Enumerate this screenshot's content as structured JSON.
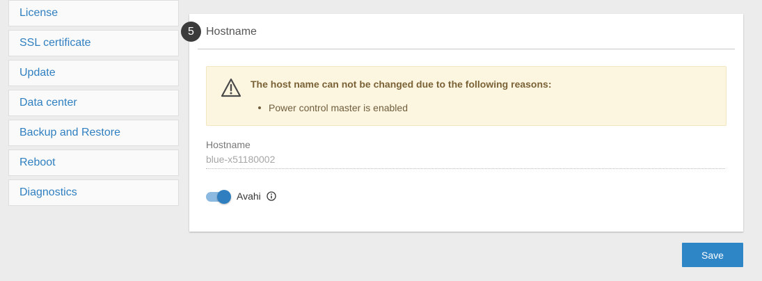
{
  "sidebar": {
    "items": [
      {
        "label": "License"
      },
      {
        "label": "SSL certificate"
      },
      {
        "label": "Update"
      },
      {
        "label": "Data center"
      },
      {
        "label": "Backup and Restore"
      },
      {
        "label": "Reboot"
      },
      {
        "label": "Diagnostics"
      }
    ]
  },
  "card": {
    "step": "5",
    "title": "Hostname",
    "warning": {
      "icon": "warning-triangle-icon",
      "title": "The host name can not be changed due to the following reasons:",
      "reasons": [
        "Power control master is enabled"
      ]
    },
    "hostname": {
      "label": "Hostname",
      "value": "blue-x51180002"
    },
    "avahi": {
      "label": "Avahi",
      "enabled": true,
      "info_icon": "info-circle-icon"
    }
  },
  "actions": {
    "save_label": "Save"
  },
  "colors": {
    "link": "#2f7fc0",
    "primary": "#2e86c7",
    "warning_bg": "#fcf6e1",
    "warning_text": "#7a6236"
  }
}
